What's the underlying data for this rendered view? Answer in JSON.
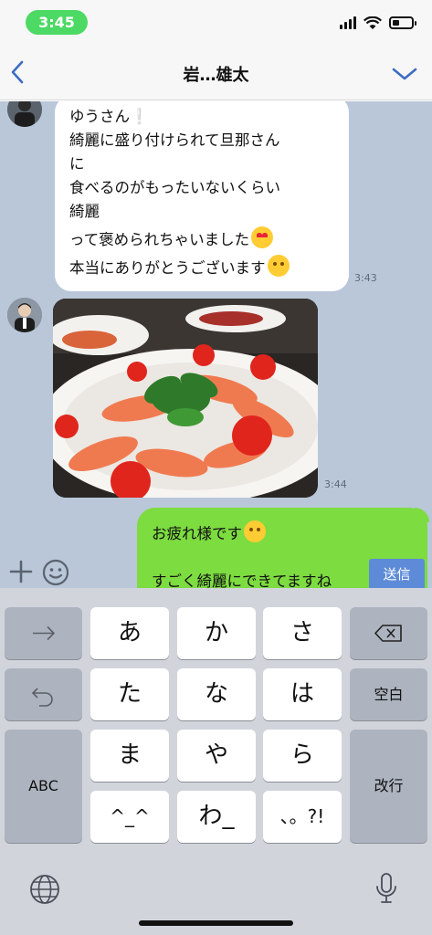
{
  "status": {
    "time": "3:45"
  },
  "header": {
    "title": "岩…雄太"
  },
  "messages": {
    "incoming_text": {
      "lines": [
        "ゆうさん❕",
        "綺麗に盛り付けられて旦那さん",
        "に",
        "食べるのがもったいないくらい",
        "綺麗",
        "って褒められちゃいました",
        "本当にありがとうございます"
      ],
      "emoji_line6": "heart-eyes-emoji",
      "emoji_line7": "smiling-face-emoji",
      "time": "3:43"
    },
    "incoming_photo": {
      "time": "3:44",
      "alt_icon": "food-photo"
    },
    "outgoing_draft": {
      "line1": "お疲れ様です",
      "line2": "すごく綺麗にできてますね"
    }
  },
  "input": {
    "send_label": "送信"
  },
  "keyboard": {
    "keys": {
      "a": "あ",
      "ka": "か",
      "sa": "さ",
      "ta": "た",
      "na": "な",
      "ha": "は",
      "ma": "ま",
      "ya": "や",
      "ra": "ら",
      "kao": "^_^",
      "wa": "わ_",
      "punct": "、。?!",
      "space": "空白",
      "abc": "ABC",
      "enter": "改行"
    }
  },
  "colors": {
    "chat_bg": "#b9c7d9",
    "outgoing_bubble": "#7ddc40",
    "send_button": "#5d8bd8",
    "time_pill": "#4cd964"
  }
}
